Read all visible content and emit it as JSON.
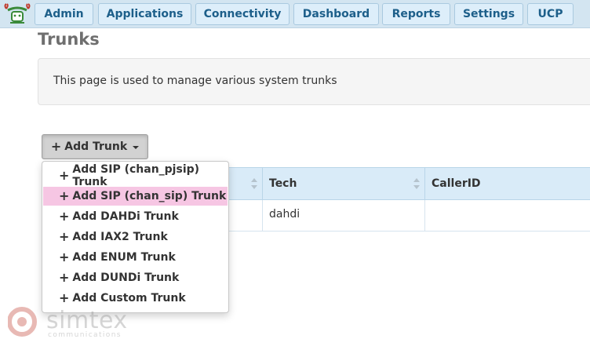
{
  "nav": {
    "items": [
      {
        "label": "Admin"
      },
      {
        "label": "Applications"
      },
      {
        "label": "Connectivity"
      },
      {
        "label": "Dashboard"
      },
      {
        "label": "Reports"
      },
      {
        "label": "Settings"
      },
      {
        "label": "UCP"
      }
    ]
  },
  "page": {
    "title": "Trunks",
    "description": "This page is used to manage various system trunks"
  },
  "toolbar": {
    "add_trunk_label": "Add Trunk"
  },
  "dropdown": {
    "items": [
      {
        "label": "Add SIP (chan_pjsip) Trunk"
      },
      {
        "label": "Add SIP (chan_sip) Trunk",
        "highlighted": true
      },
      {
        "label": "Add DAHDi Trunk"
      },
      {
        "label": "Add IAX2 Trunk"
      },
      {
        "label": "Add ENUM Trunk"
      },
      {
        "label": "Add DUNDi Trunk"
      },
      {
        "label": "Add Custom Trunk"
      }
    ]
  },
  "table": {
    "columns": [
      {
        "label": ""
      },
      {
        "label": "Tech"
      },
      {
        "label": "CallerID"
      }
    ],
    "rows": [
      {
        "cells": [
          "",
          "dahdi",
          ""
        ]
      }
    ]
  },
  "watermark": {
    "brand": "simtex",
    "tagline": "communications"
  },
  "icons": {
    "plus": "plus-icon",
    "caret": "caret-down-icon",
    "sort": "sort-icon",
    "logo": "freepbx-logo-icon"
  },
  "colors": {
    "nav_bar": "#d3e5f1",
    "nav_text": "#1d5f8a",
    "highlight": "#f6c6e3",
    "table_header": "#d9ebf8"
  }
}
